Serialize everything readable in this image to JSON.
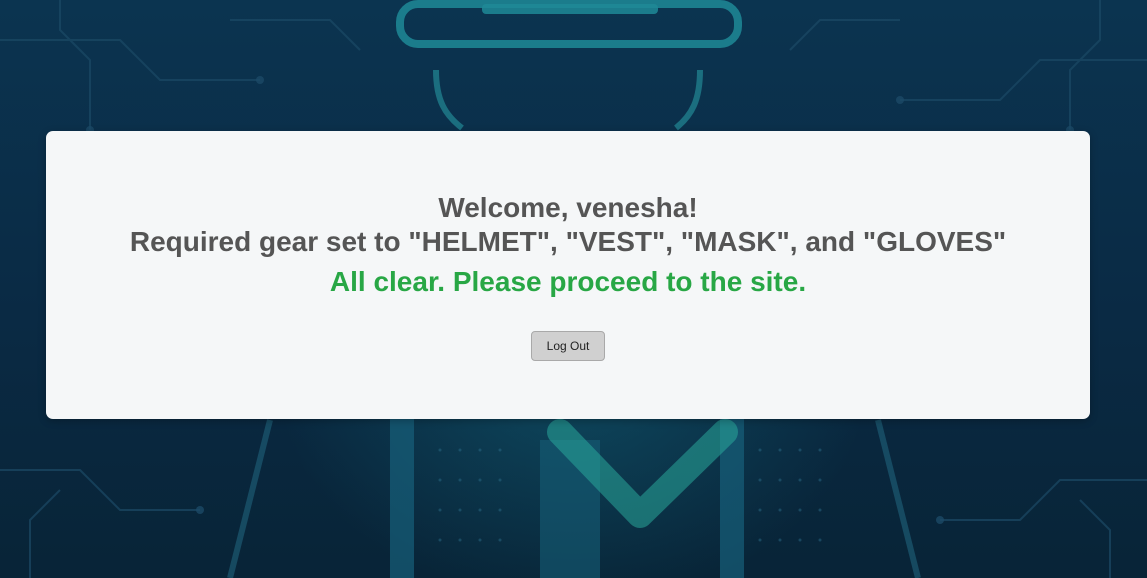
{
  "welcome_text": "Welcome, venesha!",
  "gear_text": "Required gear set to \"HELMET\", \"VEST\", \"MASK\", and \"GLOVES\"",
  "status_text": "All clear. Please proceed to the site.",
  "logout_label": "Log Out",
  "colors": {
    "background": "#0a2a44",
    "card": "#f5f7f8",
    "heading_text": "#555555",
    "success_text": "#28a745",
    "glow": "#1fa6a8"
  }
}
